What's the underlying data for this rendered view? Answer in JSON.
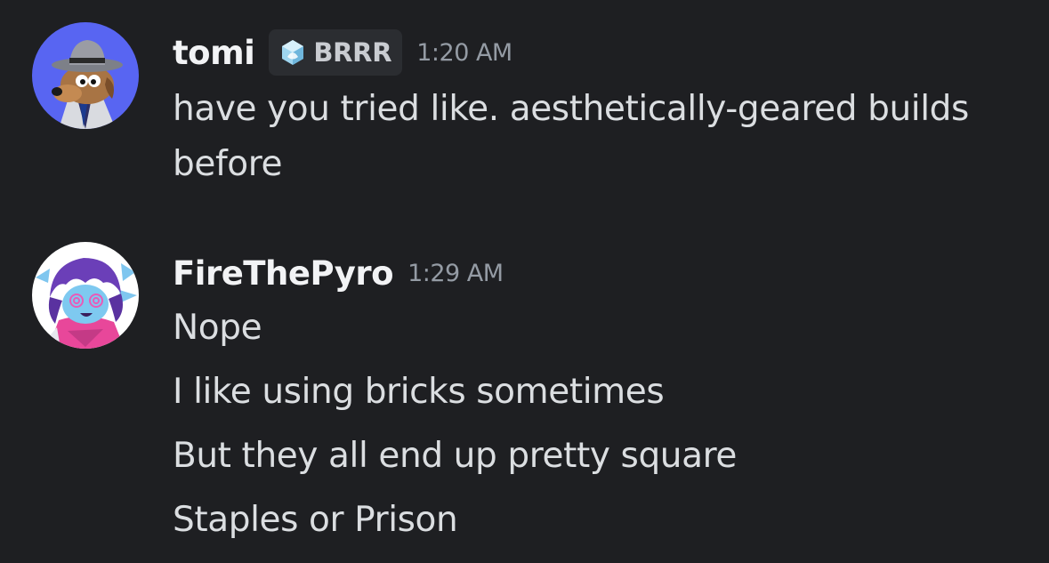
{
  "messages": [
    {
      "author": "tomi",
      "tag": {
        "label": "BRRR",
        "icon": "ice-cube-icon"
      },
      "time": "1:20 AM",
      "lines": [
        "have you tried like. aesthetically-geared builds",
        "before"
      ]
    },
    {
      "author": "FireThePyro",
      "time": "1:29 AM",
      "lines": [
        "Nope",
        "I like using bricks sometimes",
        "But they all end up pretty square",
        "Staples or Prison"
      ]
    }
  ],
  "colors": {
    "background": "#1e1f22",
    "username": "#f2f3f5",
    "message_text": "#dbdee1",
    "timestamp": "#949ba4",
    "tag_background": "#2b2d31",
    "avatar_tomi_bg": "#5865f2",
    "avatar_fire_bg": "#ffffff"
  }
}
